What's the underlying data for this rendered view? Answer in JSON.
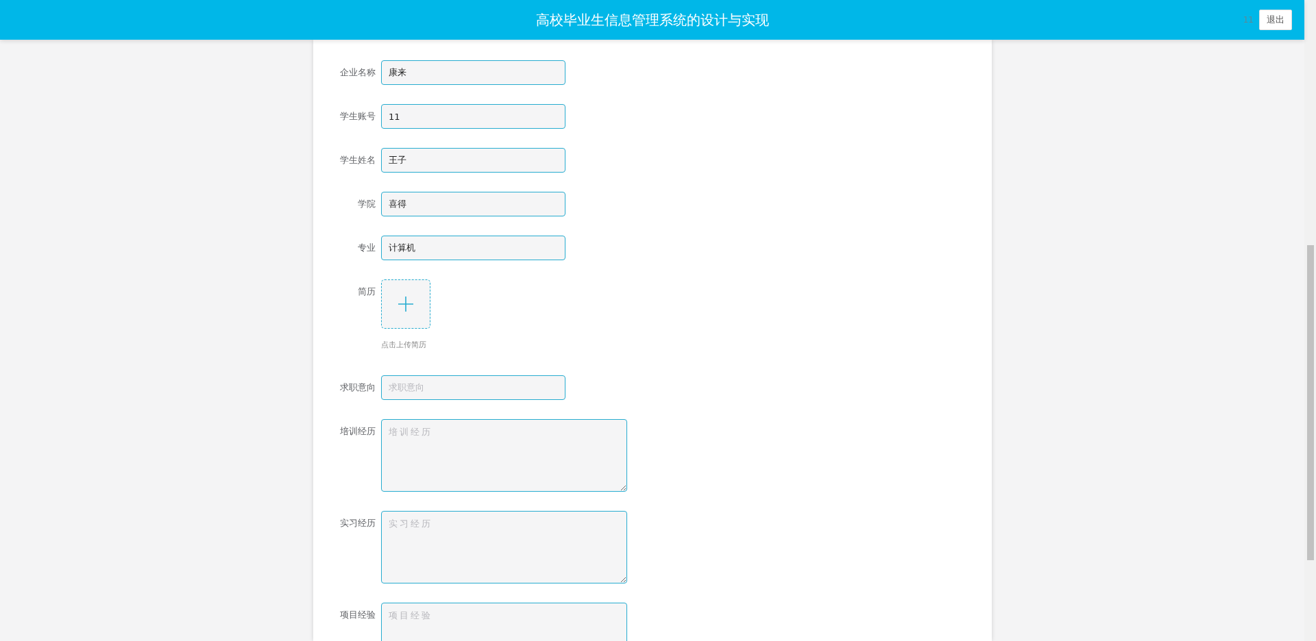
{
  "header": {
    "title": "高校毕业生信息管理系统的设计与实现",
    "user": "11",
    "logout_button": "退出"
  },
  "form": {
    "fields": [
      {
        "kind": "input",
        "label": "企业名称",
        "value": "康来"
      },
      {
        "kind": "input",
        "label": "学生账号",
        "value": "11"
      },
      {
        "kind": "input",
        "label": "学生姓名",
        "value": "王子"
      },
      {
        "kind": "input",
        "label": "学院",
        "value": "喜得"
      },
      {
        "kind": "input",
        "label": "专业",
        "value": "计算机"
      },
      {
        "kind": "upload",
        "label": "简历",
        "hint": "点击上传简历"
      },
      {
        "kind": "input",
        "label": "求职意向",
        "placeholder": "求职意向"
      },
      {
        "kind": "textarea",
        "label": "培训经历",
        "placeholder": "培训经历"
      },
      {
        "kind": "textarea",
        "label": "实习经历",
        "placeholder": "实习经历"
      },
      {
        "kind": "textarea",
        "label": "项目经验",
        "placeholder": "项目经验"
      }
    ]
  }
}
